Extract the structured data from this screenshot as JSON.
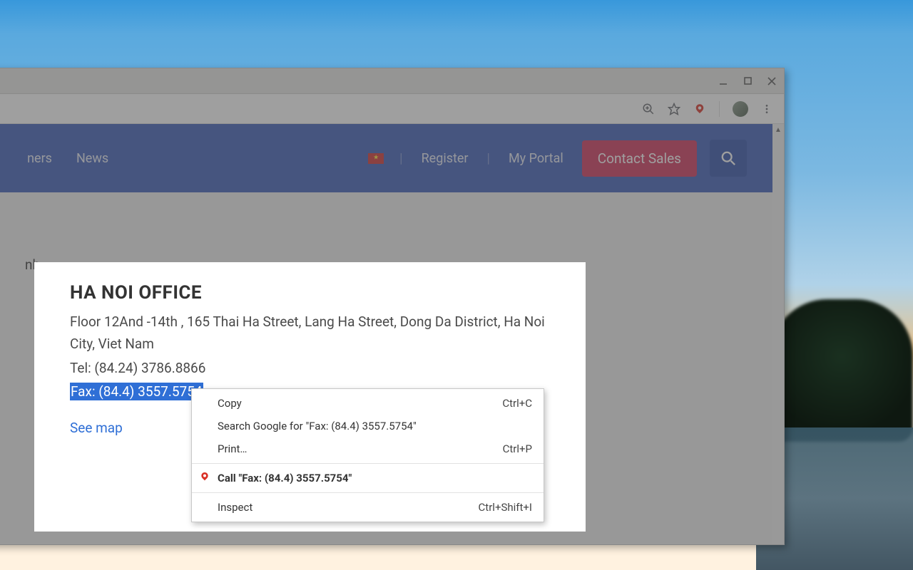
{
  "nav": {
    "partial_left_1": "ners",
    "news": "News",
    "register": "Register",
    "portal": "My Portal",
    "cta": "Contact Sales"
  },
  "page": {
    "side_text_partial": "nh"
  },
  "card": {
    "title": "HA NOI OFFICE",
    "address": "Floor 12And -14th , 165 Thai Ha Street, Lang Ha Street, Dong Da District, Ha Noi City, Viet Nam",
    "tel": "Tel: (84.24) 3786.8866",
    "fax": "Fax: (84.4) 3557.5754",
    "see_map": "See map"
  },
  "context_menu": {
    "copy": {
      "label": "Copy",
      "shortcut": "Ctrl+C"
    },
    "search": {
      "label": "Search Google for \"Fax: (84.4) 3557.5754\""
    },
    "print": {
      "label": "Print…",
      "shortcut": "Ctrl+P"
    },
    "call": {
      "label": "Call \"Fax: (84.4) 3557.5754\""
    },
    "inspect": {
      "label": "Inspect",
      "shortcut": "Ctrl+Shift+I"
    }
  }
}
